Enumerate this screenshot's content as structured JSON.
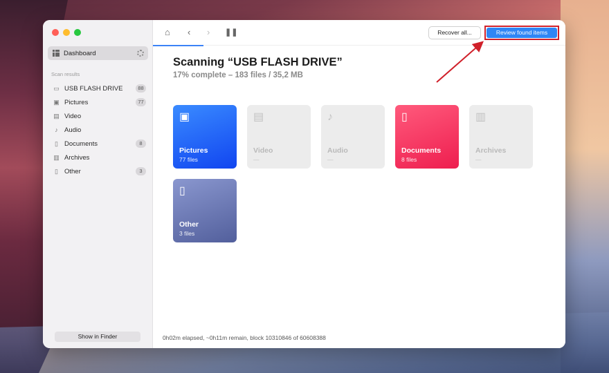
{
  "window": {
    "traffic_lights": [
      "close",
      "minimize",
      "zoom"
    ]
  },
  "sidebar": {
    "dashboard_label": "Dashboard",
    "section_label": "Scan results",
    "items": [
      {
        "label": "USB FLASH DRIVE",
        "count": "88",
        "icon": "drive-icon"
      },
      {
        "label": "Pictures",
        "count": "77",
        "icon": "picture-icon"
      },
      {
        "label": "Video",
        "count": "",
        "icon": "video-icon"
      },
      {
        "label": "Audio",
        "count": "",
        "icon": "music-note-icon"
      },
      {
        "label": "Documents",
        "count": "8",
        "icon": "document-icon"
      },
      {
        "label": "Archives",
        "count": "",
        "icon": "archive-icon"
      },
      {
        "label": "Other",
        "count": "3",
        "icon": "file-icon"
      }
    ],
    "finder_button": "Show in Finder"
  },
  "toolbar": {
    "icons": [
      "home-icon",
      "back-icon",
      "forward-icon",
      "pause-icon"
    ],
    "recover_label": "Recover all...",
    "review_label": "Review found items"
  },
  "scan": {
    "title": "Scanning “USB FLASH DRIVE”",
    "subtitle": "17% complete – 183 files / 35,2 MB",
    "progress_percent": 17
  },
  "cards": [
    {
      "name": "Pictures",
      "count": "77 files",
      "icon": "picture-icon",
      "active": true,
      "color": "#1f6dff"
    },
    {
      "name": "Video",
      "count": "—",
      "icon": "video-icon",
      "active": false,
      "color": "#ececec"
    },
    {
      "name": "Audio",
      "count": "—",
      "icon": "music-note-icon",
      "active": false,
      "color": "#ececec"
    },
    {
      "name": "Documents",
      "count": "8 files",
      "icon": "document-icon",
      "active": true,
      "color": "#f0325d"
    },
    {
      "name": "Archives",
      "count": "—",
      "icon": "archive-icon",
      "active": false,
      "color": "#ececec"
    },
    {
      "name": "Other",
      "count": "3 files",
      "icon": "file-icon",
      "active": true,
      "color": "#6573b0"
    }
  ],
  "status": "0h02m elapsed, ~0h11m remain, block 10310846 of 60608388",
  "colors": {
    "accent": "#2f86f5",
    "highlight": "#d0202a"
  }
}
